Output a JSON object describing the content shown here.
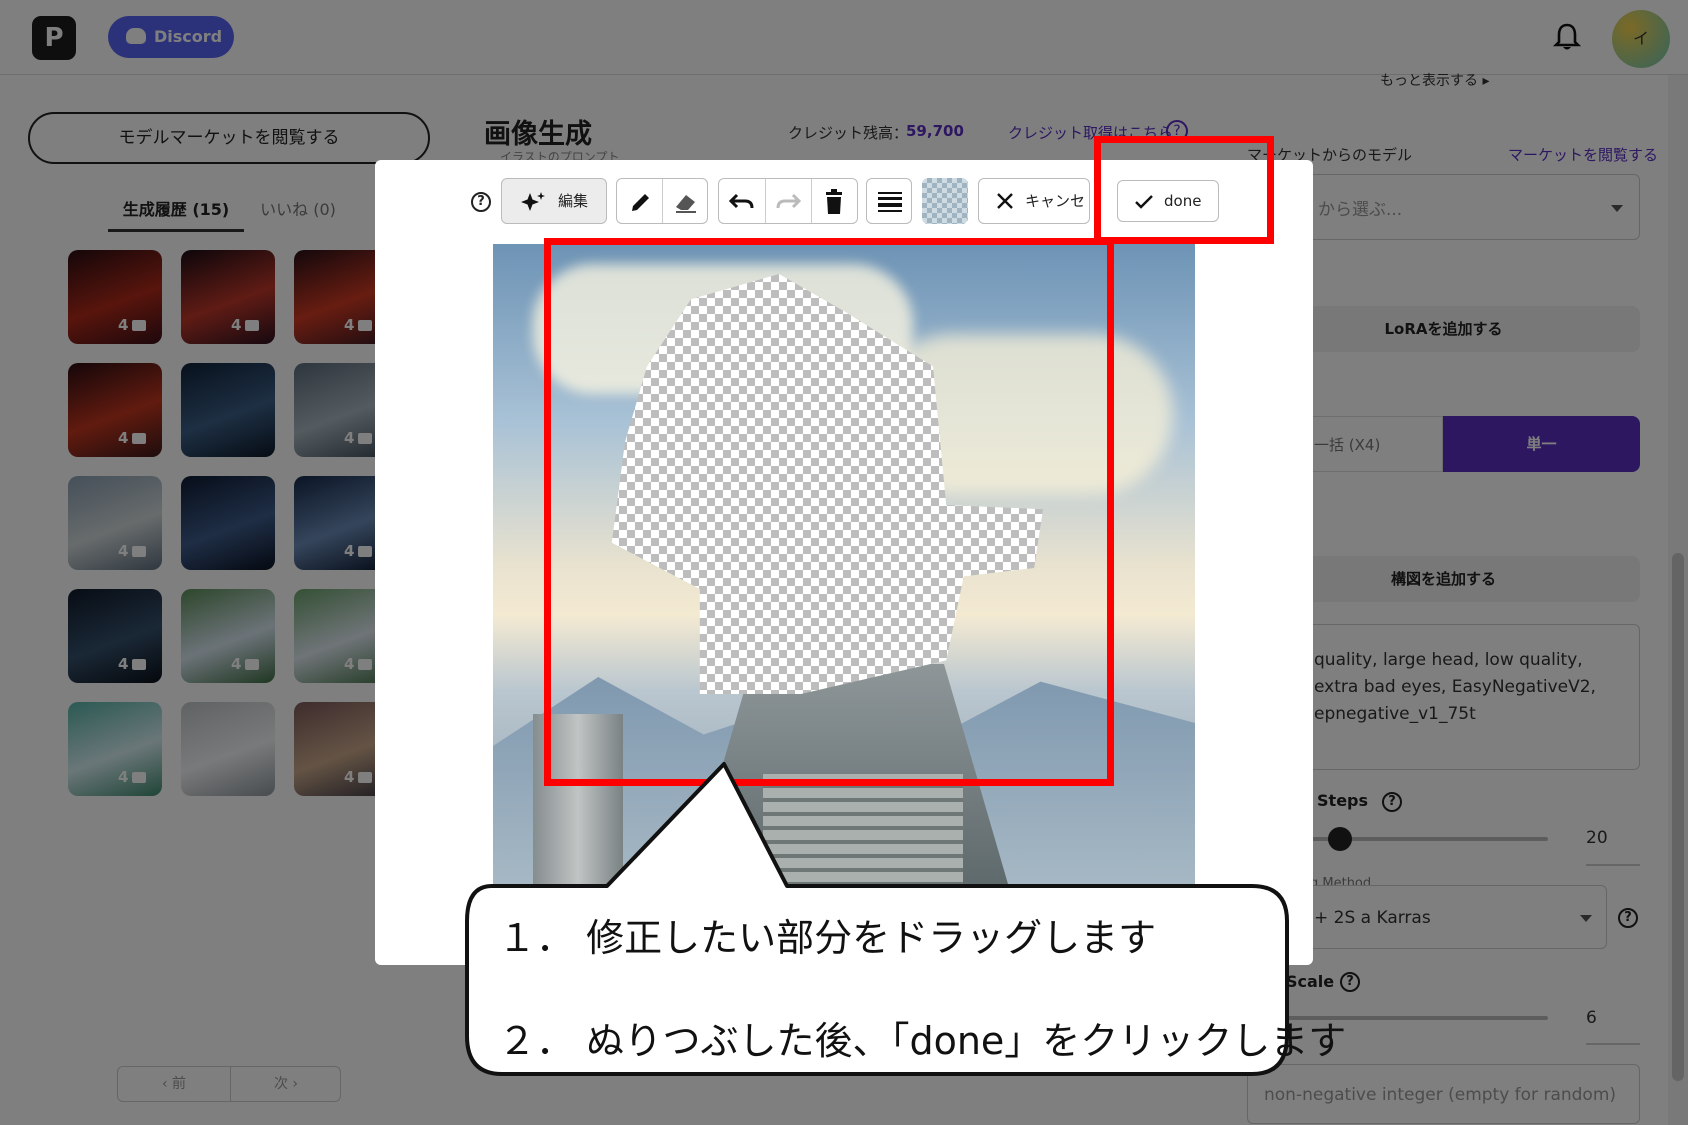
{
  "header": {
    "logo_letter": "P",
    "discord_label": "Discord",
    "avatar_initial": "イ"
  },
  "left": {
    "market_button": "モデルマーケットを閲覧する",
    "tab_history": "生成履歴 (15)",
    "tab_likes": "いいね (0)",
    "thumbnails": [
      {
        "count": "4"
      },
      {
        "count": "4"
      },
      {
        "count": "4"
      },
      {
        "count": "4"
      },
      {
        "count": ""
      },
      {
        "count": "4"
      },
      {
        "count": "4"
      },
      {
        "count": ""
      },
      {
        "count": "4"
      },
      {
        "count": "4"
      },
      {
        "count": "4"
      },
      {
        "count": "4"
      },
      {
        "count": "4"
      },
      {
        "count": ""
      },
      {
        "count": "4"
      }
    ],
    "pager_prev": "‹ 前",
    "pager_next": "次 ›"
  },
  "main": {
    "title": "画像生成",
    "subtitle": "イラストのプロンプト",
    "credit_label": "クレジット残高：",
    "credit_value": "59,700",
    "credit_link": "クレジット取得はこちら",
    "credit_help": "?"
  },
  "right": {
    "more_link": "もっと表示する ▸",
    "model_label": "マーケットからのモデル",
    "market_link": "マーケットを閲覧する",
    "model_placeholder": "から選ぶ...",
    "lora_button": "LoRAを追加する",
    "batch_option": "一括 (X4)",
    "single_option": "単一",
    "composition_button": "構図を追加する",
    "negative_prompt": "quality, large head, low quality, extra bad eyes, EasyNegativeV2, epnegative_v1_75t",
    "steps_label": "g Steps",
    "steps_value": "20",
    "steps_fraction": 0.25,
    "method_label": "g Method",
    "method_value": "+ 2S a Karras",
    "scale_label": "Scale",
    "scale_value": "6",
    "seed_placeholder": "non-negative integer (empty for random)"
  },
  "modal": {
    "help": "?",
    "edit_label": "編集",
    "cancel_label": "キャンセル",
    "done_label": "done"
  },
  "callout": {
    "line1": "１．  修正したい部分をドラッグします",
    "line2": "２．  ぬりつぶした後、「done」をクリックします"
  },
  "colors": {
    "accent": "#5b2fc2",
    "discord": "#5865F2",
    "annotation": "#ff0000"
  }
}
